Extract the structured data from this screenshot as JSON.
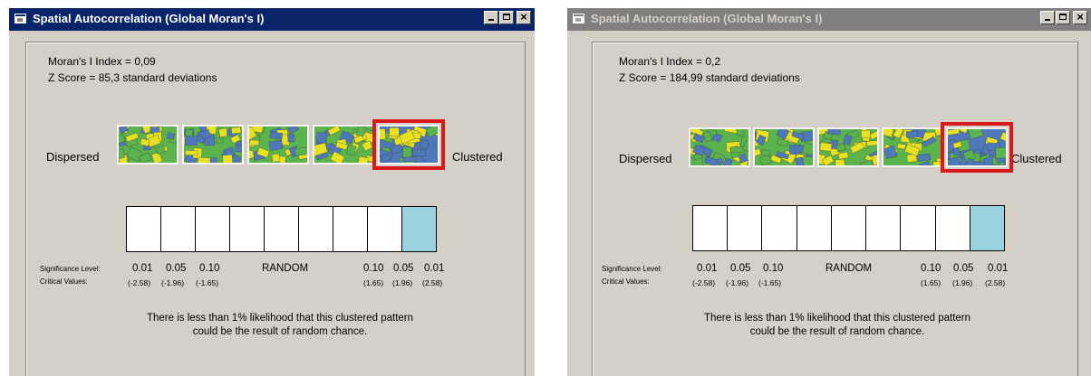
{
  "windows": [
    {
      "id": "a",
      "title": "Spatial Autocorrelation (Global Moran's I)",
      "active": true,
      "titlebar_color": "#0a246a",
      "moran_index": "Moran's I Index = 0,09",
      "z_score": "Z Score = 85,3 standard deviations",
      "dispersed_label": "Dispersed",
      "clustered_label": "Clustered",
      "highlighted_pattern": 5,
      "highlight_color": "#d81a1a",
      "bins_count": 9,
      "filled_bin": 9,
      "bin_fill_color": "#9ad3e0",
      "significance_label": "Significance Level:",
      "critical_label": "Critical Values:",
      "significance_levels": [
        "0.01",
        "0.05",
        "0.10",
        "RANDOM",
        "0.10",
        "0.05",
        "0.01"
      ],
      "critical_values": [
        "(-2.58)",
        "(-1.96)",
        "(-1.65)",
        "(1.65)",
        "(1.96)",
        "(2.58)"
      ],
      "message_line1": "There is less than 1% likelihood that this clustered pattern",
      "message_line2": "could be the result of random chance."
    },
    {
      "id": "b",
      "title": "Spatial Autocorrelation (Global Moran's I)",
      "active": false,
      "titlebar_color": "#808080",
      "moran_index": "Moran's I Index = 0,2",
      "z_score": "Z Score = 184,99 standard deviations",
      "dispersed_label": "Dispersed",
      "clustered_label": "Clustered",
      "highlighted_pattern": 5,
      "highlight_color": "#d81a1a",
      "bins_count": 9,
      "filled_bin": 9,
      "bin_fill_color": "#9ad3e0",
      "significance_label": "Significance Level:",
      "critical_label": "Critical Values:",
      "significance_levels": [
        "0.01",
        "0.05",
        "0.10",
        "RANDOM",
        "0.10",
        "0.05",
        "0.01"
      ],
      "critical_values": [
        "(-2.58)",
        "(-1.96)",
        "(-1.65)",
        "(1.65)",
        "(1.96)",
        "(2.58)"
      ],
      "message_line1": "There is less than 1% likelihood that this clustered pattern",
      "message_line2": "could be the result of random chance."
    }
  ],
  "pattern_colors": {
    "yellow": "#e8e022",
    "green": "#5bb34e",
    "blue": "#4f78b8"
  }
}
